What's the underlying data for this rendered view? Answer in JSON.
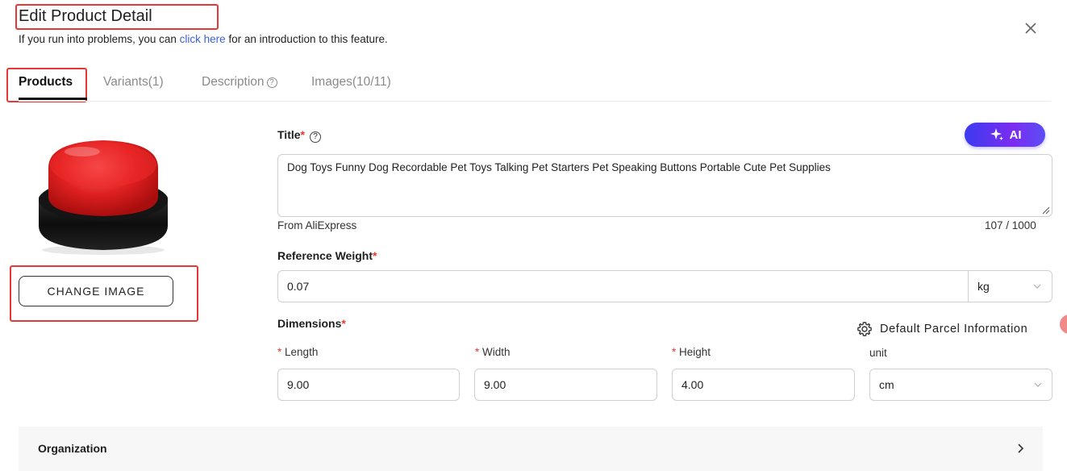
{
  "header": {
    "title": "Edit Product Detail",
    "intro_prefix": "If you run into problems, you can ",
    "intro_link": "click here",
    "intro_suffix": " for an introduction to this feature."
  },
  "tabs": [
    {
      "label": "Products",
      "active": true
    },
    {
      "label": "Variants(1)",
      "active": false
    },
    {
      "label": "Description",
      "active": false
    },
    {
      "label": "Images(10/11)",
      "active": false
    }
  ],
  "image_panel": {
    "change_image_label": "CHANGE IMAGE"
  },
  "form": {
    "title_label": "Title",
    "ai_label": "AI",
    "title_value": "Dog Toys Funny Dog Recordable Pet Toys Talking Pet Starters Pet Speaking Buttons Portable Cute Pet Supplies",
    "source": "From AliExpress",
    "char_count": "107 / 1000",
    "weight_label": "Reference Weight",
    "weight_value": "0.07",
    "weight_unit": "kg",
    "dimensions_label": "Dimensions",
    "parcel_label": "Default Parcel Information",
    "length_label": "Length",
    "width_label": "Width",
    "height_label": "Height",
    "unit_label": "unit",
    "length_value": "9.00",
    "width_value": "9.00",
    "height_value": "4.00",
    "dimension_unit": "cm",
    "required_mark": "*"
  },
  "organization": {
    "label": "Organization"
  },
  "colors": {
    "accent_link": "#3c5fd6",
    "required": "#e53935",
    "highlight_box": "#e53935",
    "ai_gradient_start": "#3b3bf0",
    "ai_gradient_end": "#7c2cf0"
  },
  "icons": [
    "close-icon",
    "help-icon",
    "ai-sparkle-icon",
    "gear-icon",
    "chevron-down-icon",
    "chevron-right-icon"
  ]
}
